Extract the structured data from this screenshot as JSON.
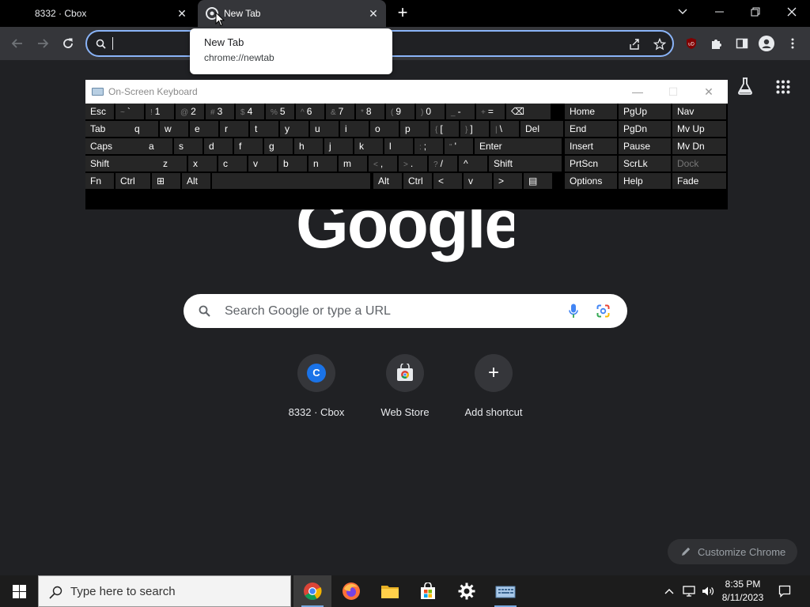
{
  "window": {
    "tabs": [
      {
        "title": "8332 · Cbox",
        "active": false
      },
      {
        "title": "New Tab",
        "active": true
      }
    ],
    "controls": [
      "tab-search",
      "minimize",
      "restore",
      "close"
    ]
  },
  "toolbar": {
    "omnibox_value": "",
    "accent_color": "#8ab4f8"
  },
  "tooltip": {
    "title": "New Tab",
    "url": "chrome://newtab"
  },
  "osk": {
    "title": "On-Screen Keyboard",
    "rows": [
      [
        [
          "Esc",
          ""
        ],
        [
          "`",
          "~"
        ],
        [
          "1",
          "!"
        ],
        [
          "2",
          "@"
        ],
        [
          "3",
          "#"
        ],
        [
          "4",
          "$"
        ],
        [
          "5",
          "%"
        ],
        [
          "6",
          "^"
        ],
        [
          "7",
          "&"
        ],
        [
          "8",
          "*"
        ],
        [
          "9",
          "("
        ],
        [
          "0",
          ")"
        ],
        [
          "-",
          "_"
        ],
        [
          "=",
          "+"
        ],
        [
          "⌫",
          ""
        ]
      ],
      [
        [
          "Tab",
          ""
        ],
        [
          "q",
          ""
        ],
        [
          "w",
          ""
        ],
        [
          "e",
          ""
        ],
        [
          "r",
          ""
        ],
        [
          "t",
          ""
        ],
        [
          "y",
          ""
        ],
        [
          "u",
          ""
        ],
        [
          "i",
          ""
        ],
        [
          "o",
          ""
        ],
        [
          "p",
          ""
        ],
        [
          "[",
          "{"
        ],
        [
          "]",
          "}"
        ],
        [
          "\\",
          "|"
        ],
        [
          "Del",
          ""
        ]
      ],
      [
        [
          "Caps",
          ""
        ],
        [
          "a",
          ""
        ],
        [
          "s",
          ""
        ],
        [
          "d",
          ""
        ],
        [
          "f",
          ""
        ],
        [
          "g",
          ""
        ],
        [
          "h",
          ""
        ],
        [
          "j",
          ""
        ],
        [
          "k",
          ""
        ],
        [
          "l",
          ""
        ],
        [
          ";",
          ":"
        ],
        [
          "'",
          "\""
        ],
        [
          "Enter",
          ""
        ]
      ],
      [
        [
          "Shift",
          ""
        ],
        [
          "z",
          ""
        ],
        [
          "x",
          ""
        ],
        [
          "c",
          ""
        ],
        [
          "v",
          ""
        ],
        [
          "b",
          ""
        ],
        [
          "n",
          ""
        ],
        [
          "m",
          ""
        ],
        [
          ",",
          "<"
        ],
        [
          ".",
          ">"
        ],
        [
          "/",
          "?"
        ],
        [
          "^",
          ""
        ],
        [
          "Shift",
          ""
        ]
      ],
      [
        [
          "Fn",
          ""
        ],
        [
          "Ctrl",
          ""
        ],
        [
          "⊞",
          ""
        ],
        [
          "Alt",
          ""
        ],
        [
          "",
          ""
        ],
        [
          "Alt",
          ""
        ],
        [
          "Ctrl",
          ""
        ],
        [
          "<",
          ""
        ],
        [
          "v",
          ""
        ],
        [
          ">",
          ""
        ],
        [
          "▤",
          ""
        ]
      ]
    ],
    "side_keys": [
      [
        "Home",
        "PgUp",
        "Nav"
      ],
      [
        "End",
        "PgDn",
        "Mv Up"
      ],
      [
        "Insert",
        "Pause",
        "Mv Dn"
      ],
      [
        "PrtScn",
        "ScrLk",
        "Dock"
      ],
      [
        "Options",
        "Help",
        "Fade"
      ]
    ]
  },
  "ntp": {
    "logo_text": "Google",
    "search_placeholder": "Search Google or type a URL",
    "shortcuts": [
      {
        "label": "8332 · Cbox",
        "icon": "C"
      },
      {
        "label": "Web Store",
        "icon": "store-icon"
      },
      {
        "label": "Add shortcut",
        "icon": "+"
      }
    ],
    "customize_label": "Customize Chrome"
  },
  "taskbar": {
    "search_placeholder": "Type here to search",
    "apps": [
      "chrome-icon",
      "firefox-icon",
      "file-explorer-icon",
      "store-icon",
      "settings-icon",
      "osk-icon"
    ],
    "time": "8:35 PM",
    "date": "8/11/2023"
  }
}
